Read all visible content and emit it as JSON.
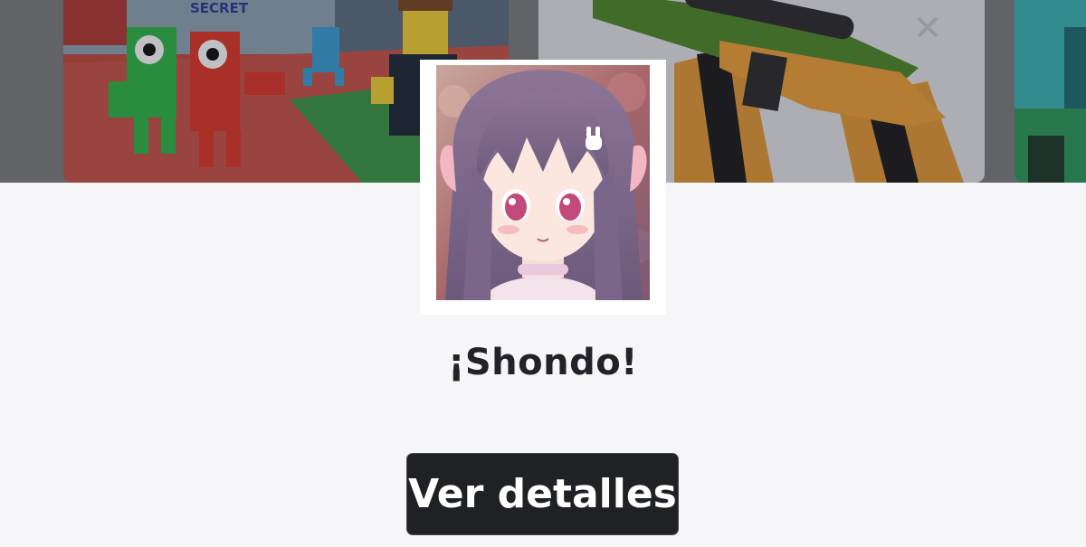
{
  "banner": {
    "thumbnails": [
      {
        "name": "game-thumbnail-rainbow-friends",
        "text": "SECRET"
      },
      {
        "name": "game-thumbnail-sniper-rifle"
      },
      {
        "name": "game-thumbnail-partial"
      }
    ]
  },
  "profile": {
    "display_name": "¡Shondo!",
    "avatar_alt": "anime girl avatar with purple hair"
  },
  "actions": {
    "details_label": "Ver detalles"
  },
  "colors": {
    "background": "#f6f6f8",
    "button_bg": "#202125",
    "button_text": "#ffffff",
    "title_text": "#222328"
  }
}
